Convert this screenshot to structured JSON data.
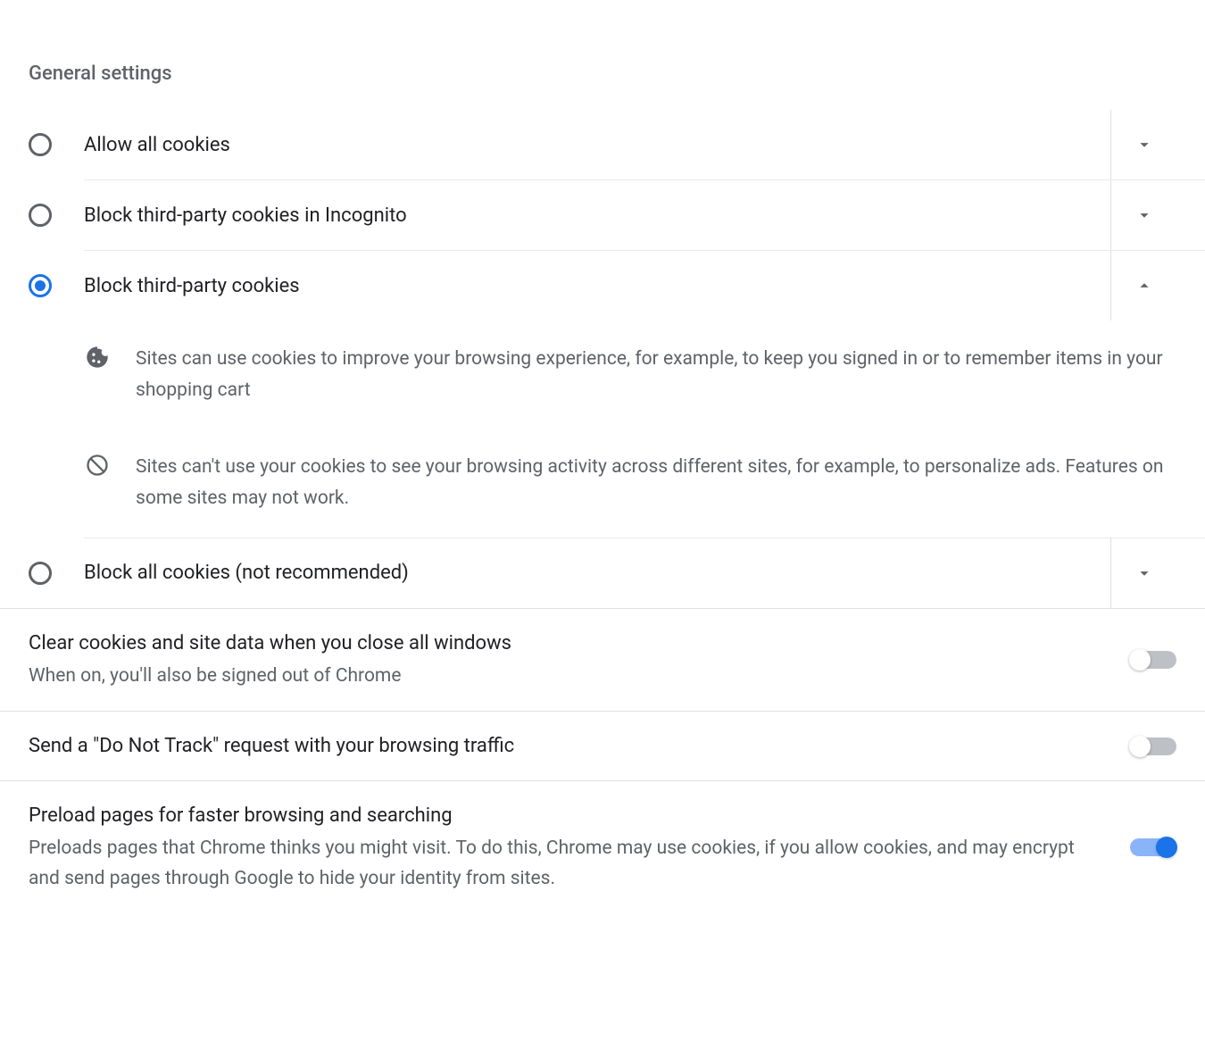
{
  "section_title": "General settings",
  "cookie_options": [
    {
      "label": "Allow all cookies",
      "selected": false,
      "expanded": false
    },
    {
      "label": "Block third-party cookies in Incognito",
      "selected": false,
      "expanded": false
    },
    {
      "label": "Block third-party cookies",
      "selected": true,
      "expanded": true
    },
    {
      "label": "Block all cookies (not recommended)",
      "selected": false,
      "expanded": false
    }
  ],
  "expanded_details": [
    {
      "icon": "cookie",
      "text": "Sites can use cookies to improve your browsing experience, for example, to keep you signed in or to remember items in your shopping cart"
    },
    {
      "icon": "block",
      "text": "Sites can't use your cookies to see your browsing activity across different sites, for example, to personalize ads. Features on some sites may not work."
    }
  ],
  "toggles": [
    {
      "title": "Clear cookies and site data when you close all windows",
      "sub": "When on, you'll also be signed out of Chrome",
      "on": false
    },
    {
      "title": "Send a \"Do Not Track\" request with your browsing traffic",
      "sub": "",
      "on": false
    },
    {
      "title": "Preload pages for faster browsing and searching",
      "sub": "Preloads pages that Chrome thinks you might visit. To do this, Chrome may use cookies, if you allow cookies, and may encrypt and send pages through Google to hide your identity from sites.",
      "on": true
    }
  ]
}
